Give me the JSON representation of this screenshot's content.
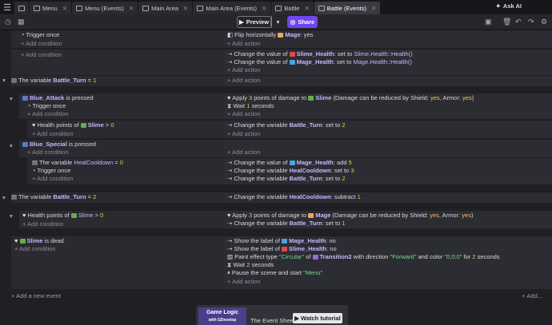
{
  "tabs": [
    {
      "label": "",
      "icon": "home-icon"
    },
    {
      "label": "Menu",
      "icon": "scene-icon"
    },
    {
      "label": "Menu (Events)",
      "icon": "events-icon"
    },
    {
      "label": "Main Area",
      "icon": "scene-icon"
    },
    {
      "label": "Main Area (Events)",
      "icon": "events-icon"
    },
    {
      "label": "Battle",
      "icon": "scene-icon"
    },
    {
      "label": "Battle (Events)",
      "icon": "events-icon",
      "active": true
    }
  ],
  "ask_ai": "Ask AI",
  "preview": "Preview",
  "share": "Share",
  "add_condition": "+ Add condition",
  "add_action": "+ Add action",
  "add_event": "+ Add a new event",
  "add_more": "+ Add...",
  "e1": {
    "c1": "Trigger once",
    "a1a": "Flip horizontally",
    "a1b": "Mage",
    "a1c": ": yes"
  },
  "e2": {
    "a1a": "Change the value of",
    "a1b": "Slime_Health",
    "a1c": ": set to",
    "a1d": "Slime.Health::Health()",
    "a2a": "Change the value of",
    "a2b": "Mage_Health",
    "a2c": ": set to",
    "a2d": "Mage.Health::Health()"
  },
  "e3": {
    "c1a": "The variable",
    "c1b": "Battle_Turn",
    "c1c": "=",
    "c1d": "1"
  },
  "e4": {
    "c1a": "Blue_Attack",
    "c1b": "is pressed",
    "c2": "Trigger once",
    "a1a": "Apply",
    "a1b": "3",
    "a1c": "points of damage to",
    "a1d": "Slime",
    "a1e": "(Damage can be reduced by Shield:",
    "a1f": "yes",
    "a1g": ", Armor:",
    "a1h": "yes",
    "a1i": ")",
    "a2a": "Wait",
    "a2b": "1",
    "a2c": "seconds"
  },
  "e5": {
    "c1a": "Health points of",
    "c1b": "Slime",
    "c1c": ">",
    "c1d": "0",
    "a1a": "Change the variable",
    "a1b": "Battle_Turn",
    "a1c": ": set to",
    "a1d": "2"
  },
  "e6": {
    "c1a": "Blue_Special",
    "c1b": "is pressed"
  },
  "e7": {
    "c1a": "The variable",
    "c1b": "HealCooldown",
    "c1c": "=",
    "c1d": "0",
    "c2": "Trigger once",
    "a1a": "Change the value of",
    "a1b": "Mage_Health",
    "a1c": ": add",
    "a1d": "5",
    "a2a": "Change the variable",
    "a2b": "HealCooldown",
    "a2c": ": set to",
    "a2d": "3",
    "a3a": "Change the variable",
    "a3b": "Battle_Turn",
    "a3c": ": set to",
    "a3d": "2"
  },
  "e8": {
    "c1a": "The variable",
    "c1b": "Battle_Turn",
    "c1c": "=",
    "c1d": "2",
    "a1a": "Change the variable",
    "a1b": "HealCooldown",
    "a1c": ": subtract",
    "a1d": "1"
  },
  "e9": {
    "c1a": "Health points of",
    "c1b": "Slime",
    "c1c": ">",
    "c1d": "0",
    "a1a": "Apply",
    "a1b": "3",
    "a1c": "points of damage to",
    "a1d": "Mage",
    "a1e": "(Damage can be reduced by Shield:",
    "a1f": "yes",
    "a1g": ", Armor:",
    "a1h": "yes",
    "a1i": ")",
    "a2a": "Change the variable",
    "a2b": "Battle_Turn",
    "a2c": ": set to",
    "a2d": "1"
  },
  "e10": {
    "c1a": "Slime",
    "c1b": "is dead",
    "a1a": "Show the label of",
    "a1b": "Mage_Health",
    "a1c": ": no",
    "a2a": "Show the label of",
    "a2b": "Slime_Health",
    "a2c": ": no",
    "a3a": "Paint effect type",
    "a3b": "\"Circular\"",
    "a3c": "of",
    "a3d": "Transition2",
    "a3e": "with direction",
    "a3f": "\"Forward\"",
    "a3g": "and color",
    "a3h": "\"0;0;0\"",
    "a3i": "for",
    "a3j": "2",
    "a3k": "seconds",
    "a4a": "Wait",
    "a4b": "2",
    "a4c": "seconds",
    "a5a": "Pause the scene and start",
    "a5b": "\"Menu\""
  },
  "promo": {
    "img_title": "Game Logic",
    "img_sub": "with GDevelop",
    "text": "The Event Sheet",
    "button": "Watch tutorial"
  },
  "colors": {
    "accent": "#7046f0",
    "slime_health": "#e04a4a",
    "mage_health": "#4aa3e0",
    "slime": "#5fb04a",
    "mage": "#e8a860"
  }
}
